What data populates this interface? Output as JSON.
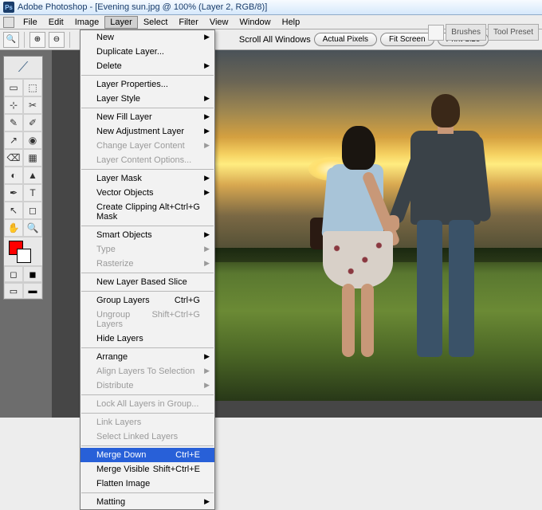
{
  "titlebar": {
    "app": "Adobe Photoshop",
    "doc": "[Evening sun.jpg @ 100% (Layer 2, RGB/8)]"
  },
  "menubar": {
    "items": [
      "File",
      "Edit",
      "Image",
      "Layer",
      "Select",
      "Filter",
      "View",
      "Window",
      "Help"
    ]
  },
  "options": {
    "scroll_all": "Scroll All Windows",
    "buttons": [
      "Actual Pixels",
      "Fit Screen",
      "Print Size"
    ]
  },
  "right_tabs": [
    "Brushes",
    "Tool Preset"
  ],
  "layer_menu": [
    {
      "label": "New",
      "sub": true
    },
    {
      "label": "Duplicate Layer..."
    },
    {
      "label": "Delete",
      "sub": true
    },
    {
      "sep": true
    },
    {
      "label": "Layer Properties..."
    },
    {
      "label": "Layer Style",
      "sub": true
    },
    {
      "sep": true
    },
    {
      "label": "New Fill Layer",
      "sub": true
    },
    {
      "label": "New Adjustment Layer",
      "sub": true
    },
    {
      "label": "Change Layer Content",
      "sub": true,
      "disabled": true
    },
    {
      "label": "Layer Content Options...",
      "disabled": true
    },
    {
      "sep": true
    },
    {
      "label": "Layer Mask",
      "sub": true
    },
    {
      "label": "Vector Objects",
      "sub": true
    },
    {
      "label": "Create Clipping Mask",
      "shortcut": "Alt+Ctrl+G"
    },
    {
      "sep": true
    },
    {
      "label": "Smart Objects",
      "sub": true
    },
    {
      "label": "Type",
      "sub": true,
      "disabled": true
    },
    {
      "label": "Rasterize",
      "sub": true,
      "disabled": true
    },
    {
      "sep": true
    },
    {
      "label": "New Layer Based Slice"
    },
    {
      "sep": true
    },
    {
      "label": "Group Layers",
      "shortcut": "Ctrl+G"
    },
    {
      "label": "Ungroup Layers",
      "shortcut": "Shift+Ctrl+G",
      "disabled": true
    },
    {
      "label": "Hide Layers"
    },
    {
      "sep": true
    },
    {
      "label": "Arrange",
      "sub": true
    },
    {
      "label": "Align Layers To Selection",
      "sub": true,
      "disabled": true
    },
    {
      "label": "Distribute",
      "sub": true,
      "disabled": true
    },
    {
      "sep": true
    },
    {
      "label": "Lock All Layers in Group...",
      "disabled": true
    },
    {
      "sep": true
    },
    {
      "label": "Link Layers",
      "disabled": true
    },
    {
      "label": "Select Linked Layers",
      "disabled": true
    },
    {
      "sep": true
    },
    {
      "label": "Merge Down",
      "shortcut": "Ctrl+E",
      "highlight": true
    },
    {
      "label": "Merge Visible",
      "shortcut": "Shift+Ctrl+E"
    },
    {
      "label": "Flatten Image"
    },
    {
      "sep": true
    },
    {
      "label": "Matting",
      "sub": true
    }
  ],
  "tools": [
    "▭",
    "⬚",
    "⊹",
    "✂",
    "✎",
    "✐",
    "↗",
    "◉",
    "⌫",
    "▦",
    "◐",
    "▲",
    "✒",
    "T",
    "↖",
    "◻",
    "✋",
    "🔍"
  ],
  "colors": {
    "fg": "#ff0000",
    "bg": "#ffffff"
  }
}
